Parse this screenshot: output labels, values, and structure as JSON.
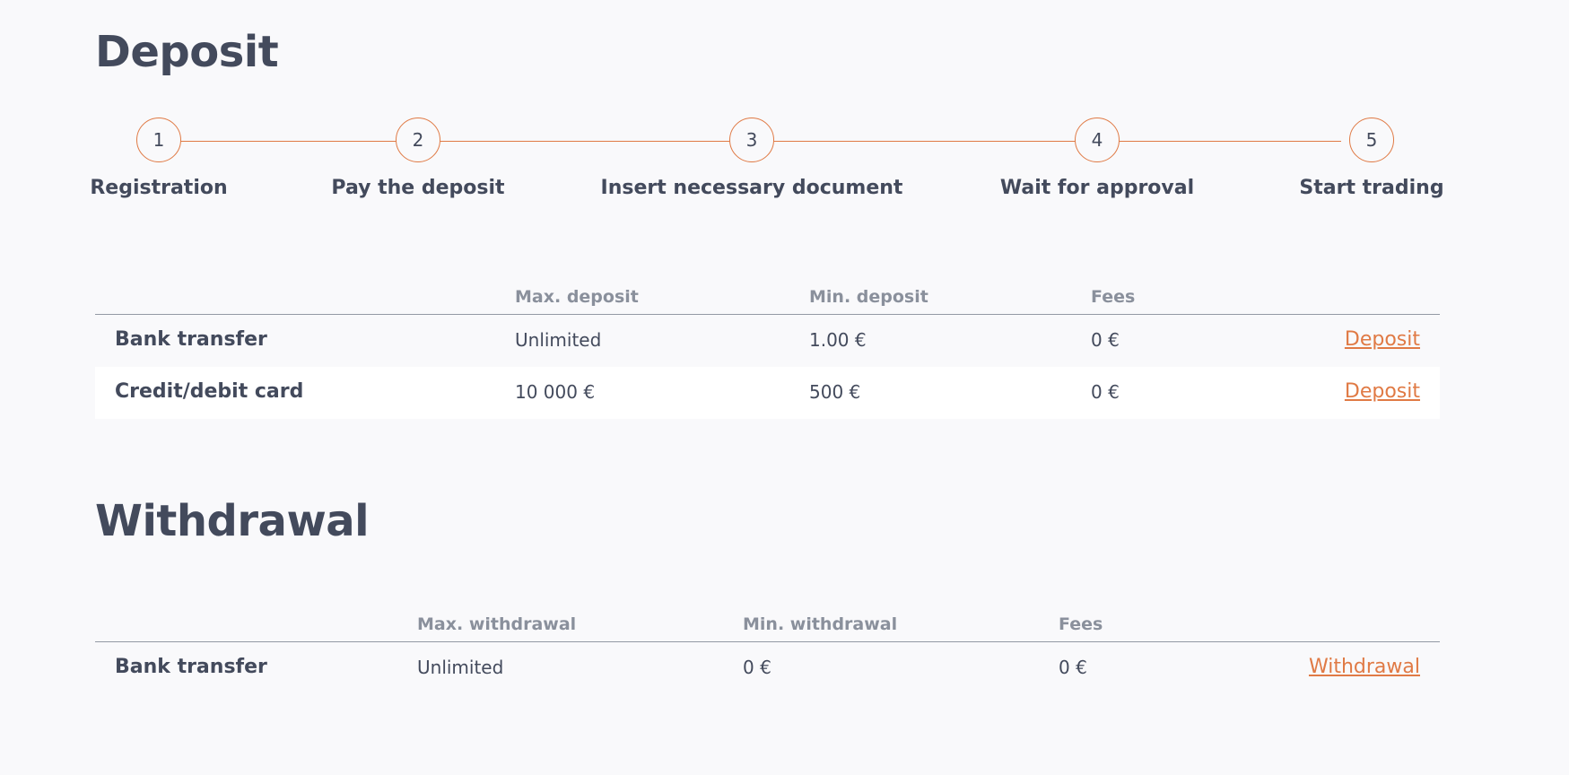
{
  "deposit": {
    "title": "Deposit",
    "steps": [
      {
        "number": "1",
        "label": "Registration"
      },
      {
        "number": "2",
        "label": "Pay the deposit"
      },
      {
        "number": "3",
        "label": "Insert necessary document"
      },
      {
        "number": "4",
        "label": "Wait for approval"
      },
      {
        "number": "5",
        "label": "Start trading"
      }
    ],
    "table": {
      "headers": [
        "Max. deposit",
        "Min. deposit",
        "Fees"
      ],
      "rows": [
        {
          "method": "Bank transfer",
          "max": "Unlimited",
          "min": "1.00 €",
          "fees": "0 €",
          "action": "Deposit"
        },
        {
          "method": "Credit/debit card",
          "max": "10 000 €",
          "min": "500 €",
          "fees": "0 €",
          "action": "Deposit"
        }
      ]
    }
  },
  "withdrawal": {
    "title": "Withdrawal",
    "table": {
      "headers": [
        "Max. withdrawal",
        "Min. withdrawal",
        "Fees"
      ],
      "rows": [
        {
          "method": "Bank transfer",
          "max": "Unlimited",
          "min": "0 €",
          "fees": "0 €",
          "action": "Withdrawal"
        }
      ]
    }
  },
  "colors": {
    "accent": "#e07a45",
    "text": "#434a5c",
    "muted": "#8a909c",
    "background": "#f9f9fb"
  }
}
